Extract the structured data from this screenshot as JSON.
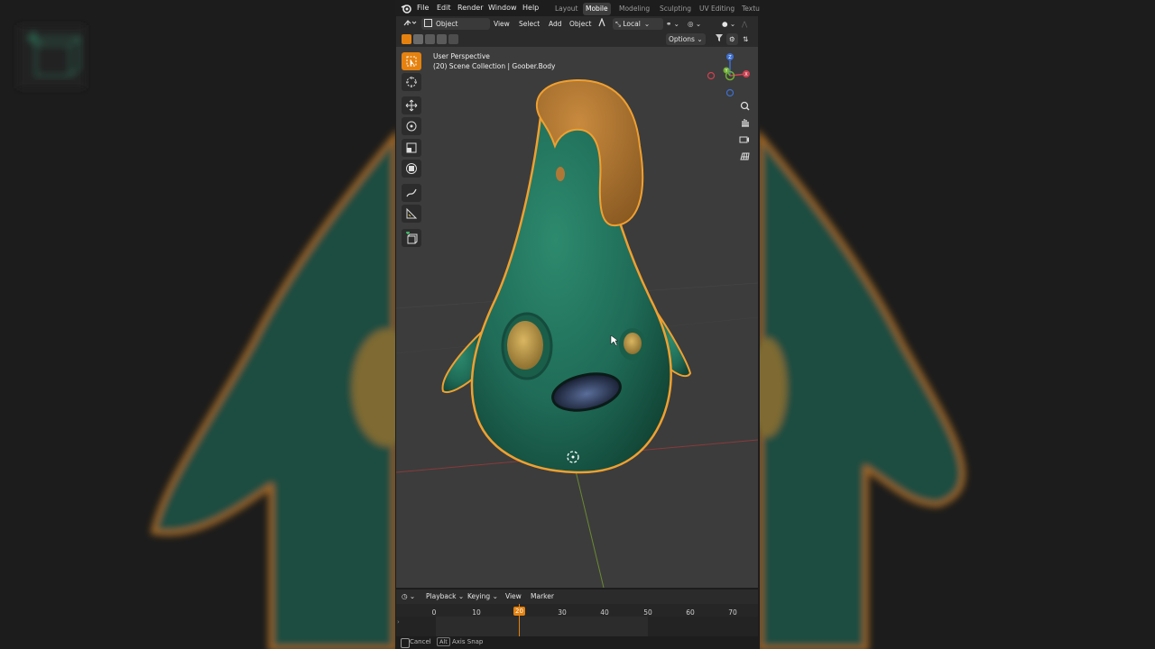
{
  "topbar": {
    "menus": [
      "File",
      "Edit",
      "Render",
      "Window",
      "Help"
    ],
    "workspaces": [
      "Layout",
      "Mobile",
      "Modeling",
      "Sculpting",
      "UV Editing",
      "Textu"
    ],
    "active_workspace": "Mobile"
  },
  "header": {
    "mode": "Object Mode",
    "view": "View",
    "select": "Select",
    "add": "Add",
    "object": "Object",
    "orientation": "Local",
    "options": "Options"
  },
  "viewport": {
    "perspective": "User Perspective",
    "collection": "(20) Scene Collection | Goober.Body",
    "gizmo_axes": [
      "Z",
      "Y",
      "X"
    ]
  },
  "toolbar": {
    "tools": [
      "select-box",
      "cursor",
      "move",
      "rotate",
      "scale",
      "transform",
      "annotate",
      "measure",
      "add-cube"
    ],
    "active_tool": "select-box"
  },
  "timeline": {
    "menus": [
      "Playback",
      "Keying",
      "View",
      "Marker"
    ],
    "ticks": [
      "0",
      "10",
      "20",
      "30",
      "40",
      "50",
      "60",
      "70"
    ],
    "current_frame": "20"
  },
  "status": {
    "cancel_label": "Cancel",
    "alt_key": "Alt",
    "axis_snap_label": "Axis Snap"
  },
  "colors": {
    "accent": "#e5820f",
    "body": "#1f6b57",
    "hair": "#a86f2c",
    "outline": "#f0a030",
    "eye": "#c7a24a"
  }
}
